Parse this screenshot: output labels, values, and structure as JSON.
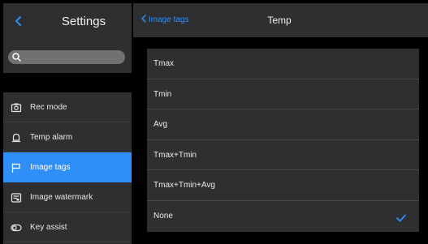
{
  "sidebar": {
    "title": "Settings",
    "search": {
      "placeholder": ""
    },
    "items": [
      {
        "label": "Rec mode",
        "icon": "camera-icon",
        "active": false
      },
      {
        "label": "Temp alarm",
        "icon": "bell-icon",
        "active": false
      },
      {
        "label": "Image tags",
        "icon": "flag-icon",
        "active": true
      },
      {
        "label": "Image watermark",
        "icon": "watermark-icon",
        "active": false
      },
      {
        "label": "Key assist",
        "icon": "key-assist-icon",
        "active": false
      }
    ]
  },
  "header": {
    "back_label": "Image tags",
    "title": "Temp"
  },
  "options": [
    {
      "label": "Tmax",
      "selected": false
    },
    {
      "label": "Tmin",
      "selected": false
    },
    {
      "label": "Avg",
      "selected": false
    },
    {
      "label": "Tmax+Tmin",
      "selected": false
    },
    {
      "label": "Tmax+Tmin+Avg",
      "selected": false
    },
    {
      "label": "None",
      "selected": true
    }
  ],
  "colors": {
    "accent": "#2f8ff6",
    "panel": "#2e2f31",
    "background": "#000000"
  }
}
